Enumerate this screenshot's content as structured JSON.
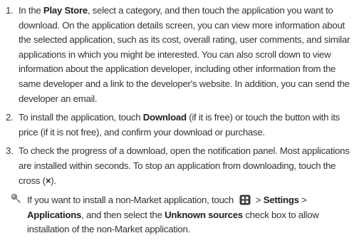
{
  "steps": [
    {
      "num": "1.",
      "parts": [
        {
          "t": "In the ",
          "b": false
        },
        {
          "t": "Play Store",
          "b": true
        },
        {
          "t": ", select a category, and then touch the application you want to download. On the application details screen, you can view more information about the selected application, such as its cost, overall rating, user comments, and similar applications in which you might be interested. You can also scroll down to view information about the application developer, including other information from the same developer and a link to the developer's website. In addition, you can send the developer an email.",
          "b": false
        }
      ]
    },
    {
      "num": "2.",
      "parts": [
        {
          "t": "To install the application, touch ",
          "b": false
        },
        {
          "t": "Download",
          "b": true
        },
        {
          "t": " (if it is free) or touch the button with its price (if it is not free), and confirm your download or purchase.",
          "b": false
        }
      ]
    },
    {
      "num": "3.",
      "parts": [
        {
          "t": "To check the progress of a download, open the notification panel. Most applications are installed within seconds. To stop an application from downloading, touch the cross (",
          "b": false
        },
        {
          "t": "×",
          "b": true
        },
        {
          "t": ").",
          "b": false
        }
      ]
    }
  ],
  "note": {
    "icon": "tip-pin-icon",
    "before_key": "If you want to install a non-Market application, touch ",
    "key_icon": "menu-key-icon",
    "after_key": " > ",
    "settings": "Settings",
    "sep": " > ",
    "applications": "Applications",
    "mid": ", and then select the ",
    "unknown_sources": "Unknown sources",
    "end": " check box to allow installation of the non-Market application."
  }
}
